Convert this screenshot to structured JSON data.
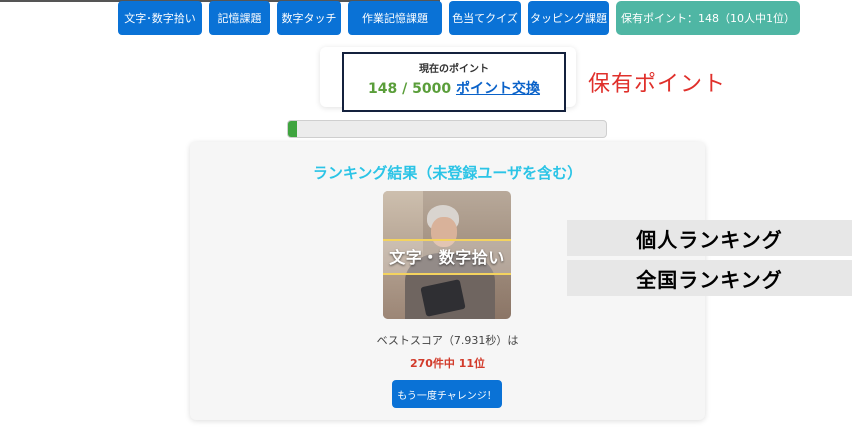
{
  "nav": {
    "items": [
      {
        "label": "文字･数字拾い"
      },
      {
        "label": "記憶課題"
      },
      {
        "label": "数字タッチ"
      },
      {
        "label": "作業記憶課題"
      },
      {
        "label": "色当てクイズ"
      },
      {
        "label": "タッピング課題"
      }
    ],
    "points_button": "保有ポイント：148（10人中1位）"
  },
  "points_panel": {
    "label": "現在のポイント",
    "value": "148 / 5000",
    "exchange_link": "ポイント交換",
    "progress_fraction": 0.0296
  },
  "annotations": {
    "held_points": "保有ポイント",
    "personal_ranking": "個人ランキング",
    "national_ranking": "全国ランキング"
  },
  "ranking": {
    "title": "ランキング結果（未登録ユーザを含む）",
    "image_caption": "文字・数字拾い",
    "best_score": "ベストスコア（7.931秒）は",
    "result": "270件中 11位",
    "retry_button": "もう一度チャレンジ！"
  },
  "colors": {
    "nav_blue": "#0a72d6",
    "points_teal": "#4fb6a4",
    "progress_green": "#3fa43f",
    "title_cyan": "#2bc4e6",
    "result_red": "#d23b2b",
    "annotation_red": "#e0302b"
  }
}
